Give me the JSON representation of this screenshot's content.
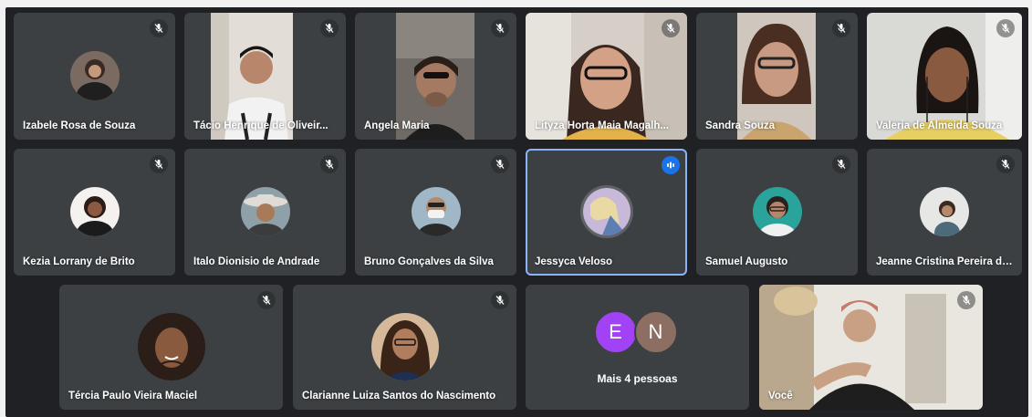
{
  "colors": {
    "stage": "#202124",
    "tile": "#3c4043",
    "active_border": "#8ab4f8",
    "speaking_badge": "#1a73e8",
    "initial_e": "#a142f4",
    "initial_n": "#8d6e63"
  },
  "participants": {
    "izabele": {
      "name": "Izabele Rosa de Souza",
      "state": "avatar",
      "mic": "muted"
    },
    "tacio": {
      "name": "Tácio Henrique de Oliveir...",
      "state": "video",
      "mic": "muted"
    },
    "angela": {
      "name": "Angela Maria",
      "state": "video",
      "mic": "muted"
    },
    "lityza": {
      "name": "Lityza Horta Maia Magalh...",
      "state": "video",
      "mic": "muted"
    },
    "sandra": {
      "name": "Sandra Souza",
      "state": "video",
      "mic": "muted"
    },
    "valeria": {
      "name": "Valeria de Almeida Souza",
      "state": "video",
      "mic": "muted"
    },
    "kezia": {
      "name": "Kezia Lorrany de Brito",
      "state": "avatar",
      "mic": "muted"
    },
    "italo": {
      "name": "Italo Dionisio de Andrade",
      "state": "avatar",
      "mic": "muted"
    },
    "bruno": {
      "name": "Bruno Gonçalves da Silva",
      "state": "avatar",
      "mic": "muted"
    },
    "jessyca": {
      "name": "Jessyca Veloso",
      "state": "avatar",
      "mic": "speaking"
    },
    "samuel": {
      "name": "Samuel Augusto",
      "state": "avatar",
      "mic": "muted"
    },
    "jeanne": {
      "name": "Jeanne Cristina Pereira do...",
      "state": "avatar",
      "mic": "muted"
    },
    "tercia": {
      "name": "Tércia Paulo Vieira Maciel",
      "state": "avatar",
      "mic": "muted"
    },
    "clarianne": {
      "name": "Clarianne Luiza Santos do Nascimento",
      "state": "avatar",
      "mic": "muted"
    },
    "voce": {
      "name": "Você",
      "state": "video",
      "mic": "muted"
    }
  },
  "more": {
    "label": "Mais 4 pessoas",
    "initials": [
      "E",
      "N"
    ]
  },
  "icons": {
    "muted": "mic-off-icon",
    "speaking": "audio-level-icon"
  }
}
